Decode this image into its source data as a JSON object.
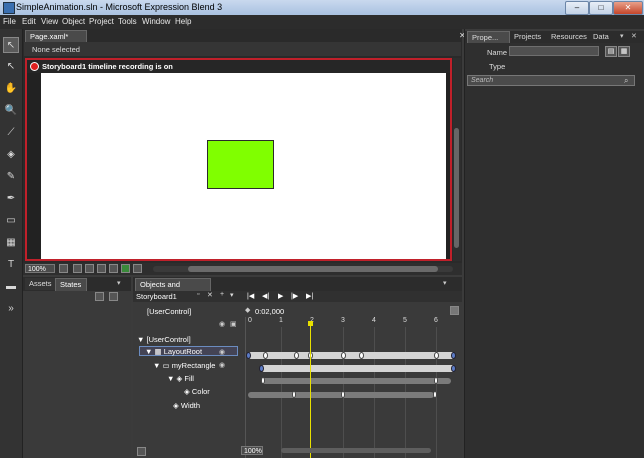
{
  "window": {
    "title": "SimpleAnimation.sln - Microsoft Expression Blend 3",
    "minimize": "–",
    "maximize": "□",
    "close": "✕"
  },
  "menu": [
    "File",
    "Edit",
    "View",
    "Object",
    "Project",
    "Tools",
    "Window",
    "Help"
  ],
  "toolbox": [
    {
      "name": "selection-tool-icon",
      "glyph": "↖"
    },
    {
      "name": "direct-selection-tool-icon",
      "glyph": "↖"
    },
    {
      "name": "pan-tool-icon",
      "glyph": "✋"
    },
    {
      "name": "zoom-tool-icon",
      "glyph": "🔍"
    },
    {
      "name": "eyedropper-tool-icon",
      "glyph": "⟋"
    },
    {
      "name": "paint-bucket-tool-icon",
      "glyph": "◈"
    },
    {
      "name": "brush-transform-tool-icon",
      "glyph": "✎"
    },
    {
      "name": "pen-tool-icon",
      "glyph": "✒"
    },
    {
      "name": "rectangle-tool-icon",
      "glyph": "▭"
    },
    {
      "name": "grid-tool-icon",
      "glyph": "▦"
    },
    {
      "name": "text-tool-icon",
      "glyph": "T"
    },
    {
      "name": "control-tool-icon",
      "glyph": "▬"
    },
    {
      "name": "asset-library-icon",
      "glyph": "»"
    }
  ],
  "document": {
    "tab_label": "Page.xaml*",
    "tab_close": "✕",
    "breadcrumb": "None selected",
    "recording_text": "Storyboard1 timeline recording is on",
    "zoom": "100%"
  },
  "left_panel": {
    "tabs": [
      "Assets",
      "States"
    ]
  },
  "objects_timeline": {
    "tab_label": "Objects and Timeline",
    "storyboard": "Storyboard1",
    "timecode": "0:02,000",
    "root": "[UserControl]",
    "tree": [
      {
        "label": "[UserControl]",
        "indent": 0
      },
      {
        "label": "LayoutRoot",
        "indent": 1
      },
      {
        "label": "myRectangle",
        "indent": 2
      },
      {
        "label": "Fill",
        "indent": 3
      },
      {
        "label": "Color",
        "indent": 4
      },
      {
        "label": "Width",
        "indent": 3
      }
    ],
    "ticks": [
      "0",
      "1",
      "2",
      "3",
      "4",
      "5",
      "6"
    ],
    "zoom": "100%",
    "playhead_seconds": 2.0
  },
  "right_panel": {
    "tabs": [
      "Prope...",
      "Projects",
      "Resources",
      "Data"
    ],
    "name_label": "Name",
    "type_label": "Type",
    "search_placeholder": "Search"
  },
  "colors": {
    "rectangle_fill": "#80ff00",
    "recording_border": "#c0202a",
    "playhead": "#e8e000"
  }
}
